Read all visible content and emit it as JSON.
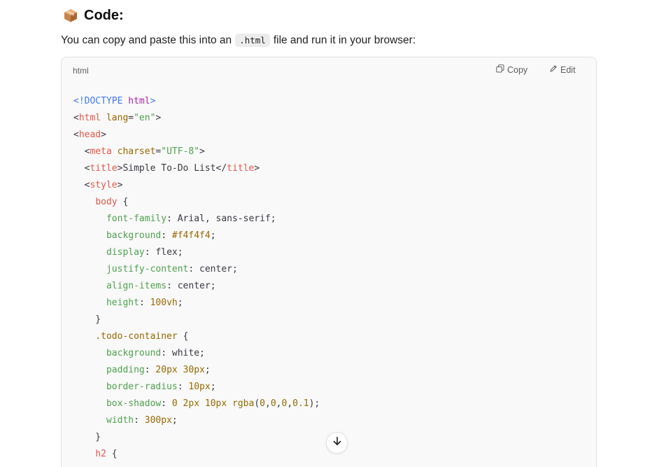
{
  "heading": {
    "icon": "package-icon",
    "text": "Code:"
  },
  "intro": {
    "before": "You can copy and paste this into an",
    "code": ".html",
    "after": "file and run it in your browser:"
  },
  "code_block": {
    "language": "html",
    "copy_label": "Copy",
    "edit_label": "Edit",
    "lines": [
      [
        {
          "t": "doc",
          "v": "<!DOCTYPE "
        },
        {
          "t": "doc-kw",
          "v": "html"
        },
        {
          "t": "doc",
          "v": ">"
        }
      ],
      [
        {
          "t": "pun",
          "v": "<"
        },
        {
          "t": "tag",
          "v": "html"
        },
        {
          "t": "pun",
          "v": " "
        },
        {
          "t": "attr",
          "v": "lang"
        },
        {
          "t": "pun",
          "v": "="
        },
        {
          "t": "str",
          "v": "\"en\""
        },
        {
          "t": "pun",
          "v": ">"
        }
      ],
      [
        {
          "t": "pun",
          "v": "<"
        },
        {
          "t": "tag",
          "v": "head"
        },
        {
          "t": "pun",
          "v": ">"
        }
      ],
      [
        {
          "t": "pun",
          "v": "  <"
        },
        {
          "t": "tag",
          "v": "meta"
        },
        {
          "t": "pun",
          "v": " "
        },
        {
          "t": "attr",
          "v": "charset"
        },
        {
          "t": "pun",
          "v": "="
        },
        {
          "t": "str",
          "v": "\"UTF-8\""
        },
        {
          "t": "pun",
          "v": ">"
        }
      ],
      [
        {
          "t": "pun",
          "v": "  <"
        },
        {
          "t": "tag",
          "v": "title"
        },
        {
          "t": "pun",
          "v": ">"
        },
        {
          "t": "txt",
          "v": "Simple To-Do List"
        },
        {
          "t": "pun",
          "v": "</"
        },
        {
          "t": "tag",
          "v": "title"
        },
        {
          "t": "pun",
          "v": ">"
        }
      ],
      [
        {
          "t": "pun",
          "v": "  <"
        },
        {
          "t": "tag",
          "v": "style"
        },
        {
          "t": "pun",
          "v": ">"
        }
      ],
      [
        {
          "t": "pun",
          "v": "    "
        },
        {
          "t": "sel",
          "v": "body"
        },
        {
          "t": "pun",
          "v": " {"
        }
      ],
      [
        {
          "t": "pun",
          "v": "      "
        },
        {
          "t": "prop",
          "v": "font-family"
        },
        {
          "t": "pun",
          "v": ": "
        },
        {
          "t": "val",
          "v": "Arial, sans-serif"
        },
        {
          "t": "pun",
          "v": ";"
        }
      ],
      [
        {
          "t": "pun",
          "v": "      "
        },
        {
          "t": "prop",
          "v": "background"
        },
        {
          "t": "pun",
          "v": ": "
        },
        {
          "t": "num",
          "v": "#f4f4f4"
        },
        {
          "t": "pun",
          "v": ";"
        }
      ],
      [
        {
          "t": "pun",
          "v": "      "
        },
        {
          "t": "prop",
          "v": "display"
        },
        {
          "t": "pun",
          "v": ": "
        },
        {
          "t": "val",
          "v": "flex"
        },
        {
          "t": "pun",
          "v": ";"
        }
      ],
      [
        {
          "t": "pun",
          "v": "      "
        },
        {
          "t": "prop",
          "v": "justify-content"
        },
        {
          "t": "pun",
          "v": ": "
        },
        {
          "t": "val",
          "v": "center"
        },
        {
          "t": "pun",
          "v": ";"
        }
      ],
      [
        {
          "t": "pun",
          "v": "      "
        },
        {
          "t": "prop",
          "v": "align-items"
        },
        {
          "t": "pun",
          "v": ": "
        },
        {
          "t": "val",
          "v": "center"
        },
        {
          "t": "pun",
          "v": ";"
        }
      ],
      [
        {
          "t": "pun",
          "v": "      "
        },
        {
          "t": "prop",
          "v": "height"
        },
        {
          "t": "pun",
          "v": ": "
        },
        {
          "t": "num",
          "v": "100vh"
        },
        {
          "t": "pun",
          "v": ";"
        }
      ],
      [
        {
          "t": "pun",
          "v": "    }"
        }
      ],
      [
        {
          "t": "pun",
          "v": "    "
        },
        {
          "t": "cls",
          "v": ".todo-container"
        },
        {
          "t": "pun",
          "v": " {"
        }
      ],
      [
        {
          "t": "pun",
          "v": "      "
        },
        {
          "t": "prop",
          "v": "background"
        },
        {
          "t": "pun",
          "v": ": "
        },
        {
          "t": "val",
          "v": "white"
        },
        {
          "t": "pun",
          "v": ";"
        }
      ],
      [
        {
          "t": "pun",
          "v": "      "
        },
        {
          "t": "prop",
          "v": "padding"
        },
        {
          "t": "pun",
          "v": ": "
        },
        {
          "t": "num",
          "v": "20px 30px"
        },
        {
          "t": "pun",
          "v": ";"
        }
      ],
      [
        {
          "t": "pun",
          "v": "      "
        },
        {
          "t": "prop",
          "v": "border-radius"
        },
        {
          "t": "pun",
          "v": ": "
        },
        {
          "t": "num",
          "v": "10px"
        },
        {
          "t": "pun",
          "v": ";"
        }
      ],
      [
        {
          "t": "pun",
          "v": "      "
        },
        {
          "t": "prop",
          "v": "box-shadow"
        },
        {
          "t": "pun",
          "v": ": "
        },
        {
          "t": "num",
          "v": "0 2px 10px"
        },
        {
          "t": "pun",
          "v": " "
        },
        {
          "t": "attr",
          "v": "rgba"
        },
        {
          "t": "pun",
          "v": "("
        },
        {
          "t": "num",
          "v": "0"
        },
        {
          "t": "pun",
          "v": ","
        },
        {
          "t": "num",
          "v": "0"
        },
        {
          "t": "pun",
          "v": ","
        },
        {
          "t": "num",
          "v": "0"
        },
        {
          "t": "pun",
          "v": ","
        },
        {
          "t": "num",
          "v": "0.1"
        },
        {
          "t": "pun",
          "v": ");"
        }
      ],
      [
        {
          "t": "pun",
          "v": "      "
        },
        {
          "t": "prop",
          "v": "width"
        },
        {
          "t": "pun",
          "v": ": "
        },
        {
          "t": "num",
          "v": "300px"
        },
        {
          "t": "pun",
          "v": ";"
        }
      ],
      [
        {
          "t": "pun",
          "v": "    }"
        }
      ],
      [
        {
          "t": "pun",
          "v": "    "
        },
        {
          "t": "sel",
          "v": "h2"
        },
        {
          "t": "pun",
          "v": " {"
        }
      ]
    ]
  },
  "scroll": {
    "icon": "arrow-down-icon"
  }
}
